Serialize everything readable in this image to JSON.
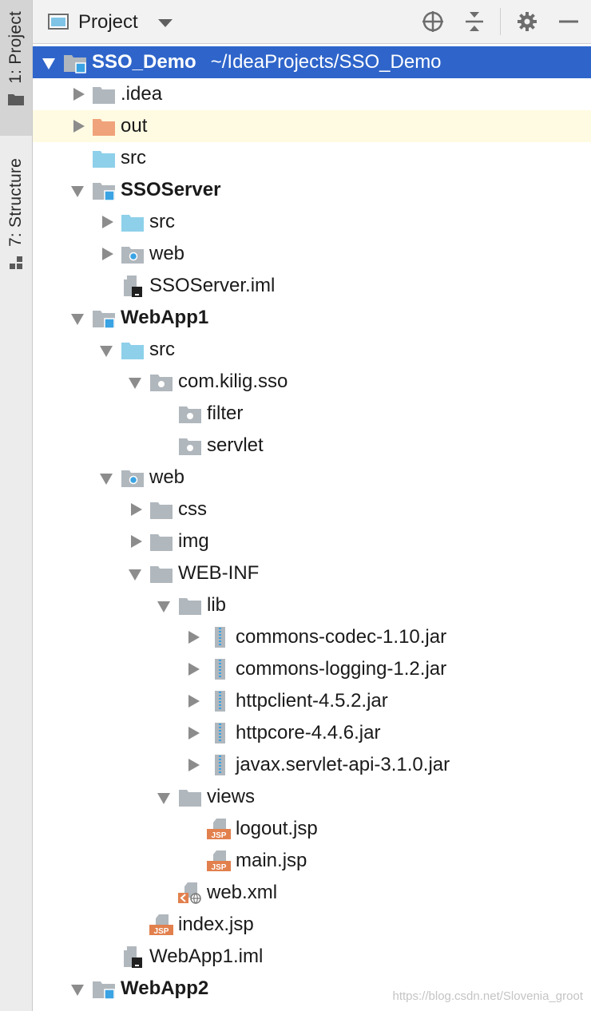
{
  "side_tabs": {
    "project": "1: Project",
    "structure": "7: Structure"
  },
  "header": {
    "title": "Project"
  },
  "tree": [
    {
      "label": "SSO_Demo",
      "path": "~/IdeaProjects/SSO_Demo",
      "depth": 0,
      "arrow": "down",
      "icon": "module-icon",
      "bold": true,
      "selected": true
    },
    {
      "label": ".idea",
      "depth": 1,
      "arrow": "right",
      "icon": "folder-icon"
    },
    {
      "label": "out",
      "depth": 1,
      "arrow": "right",
      "icon": "excluded-folder-icon",
      "highlight": true
    },
    {
      "label": "src",
      "depth": 1,
      "arrow": "none",
      "icon": "source-folder-icon"
    },
    {
      "label": "SSOServer",
      "depth": 1,
      "arrow": "down",
      "icon": "module-icon",
      "bold": true
    },
    {
      "label": "src",
      "depth": 2,
      "arrow": "right",
      "icon": "source-folder-icon"
    },
    {
      "label": "web",
      "depth": 2,
      "arrow": "right",
      "icon": "web-folder-icon"
    },
    {
      "label": "SSOServer.iml",
      "depth": 2,
      "arrow": "none",
      "icon": "iml-file-icon"
    },
    {
      "label": "WebApp1",
      "depth": 1,
      "arrow": "down",
      "icon": "module-icon",
      "bold": true
    },
    {
      "label": "src",
      "depth": 2,
      "arrow": "down",
      "icon": "source-folder-icon"
    },
    {
      "label": "com.kilig.sso",
      "depth": 3,
      "arrow": "down",
      "icon": "package-icon"
    },
    {
      "label": "filter",
      "depth": 4,
      "arrow": "none",
      "icon": "package-icon"
    },
    {
      "label": "servlet",
      "depth": 4,
      "arrow": "none",
      "icon": "package-icon"
    },
    {
      "label": "web",
      "depth": 2,
      "arrow": "down",
      "icon": "web-folder-icon"
    },
    {
      "label": "css",
      "depth": 3,
      "arrow": "right",
      "icon": "folder-icon"
    },
    {
      "label": "img",
      "depth": 3,
      "arrow": "right",
      "icon": "folder-icon"
    },
    {
      "label": "WEB-INF",
      "depth": 3,
      "arrow": "down",
      "icon": "folder-icon"
    },
    {
      "label": "lib",
      "depth": 4,
      "arrow": "down",
      "icon": "folder-icon"
    },
    {
      "label": "commons-codec-1.10.jar",
      "depth": 5,
      "arrow": "right",
      "icon": "jar-icon"
    },
    {
      "label": "commons-logging-1.2.jar",
      "depth": 5,
      "arrow": "right",
      "icon": "jar-icon"
    },
    {
      "label": "httpclient-4.5.2.jar",
      "depth": 5,
      "arrow": "right",
      "icon": "jar-icon"
    },
    {
      "label": "httpcore-4.4.6.jar",
      "depth": 5,
      "arrow": "right",
      "icon": "jar-icon"
    },
    {
      "label": "javax.servlet-api-3.1.0.jar",
      "depth": 5,
      "arrow": "right",
      "icon": "jar-icon"
    },
    {
      "label": "views",
      "depth": 4,
      "arrow": "down",
      "icon": "folder-icon"
    },
    {
      "label": "logout.jsp",
      "depth": 5,
      "arrow": "none",
      "icon": "jsp-file-icon"
    },
    {
      "label": "main.jsp",
      "depth": 5,
      "arrow": "none",
      "icon": "jsp-file-icon"
    },
    {
      "label": "web.xml",
      "depth": 4,
      "arrow": "none",
      "icon": "xml-file-icon"
    },
    {
      "label": "index.jsp",
      "depth": 3,
      "arrow": "none",
      "icon": "jsp-file-icon"
    },
    {
      "label": "WebApp1.iml",
      "depth": 2,
      "arrow": "none",
      "icon": "iml-file-icon"
    },
    {
      "label": "WebApp2",
      "depth": 1,
      "arrow": "down",
      "icon": "module-icon",
      "bold": true
    }
  ],
  "watermark": "https://blog.csdn.net/Slovenia_groot",
  "colors": {
    "selection": "#2f65ca",
    "highlight_row": "#fefbe2",
    "folder": "#b0b7bd",
    "source_folder": "#8ed0ea",
    "excluded_folder": "#f0a27a",
    "module_badge": "#3aa3e3",
    "jsp": "#e2804d"
  }
}
